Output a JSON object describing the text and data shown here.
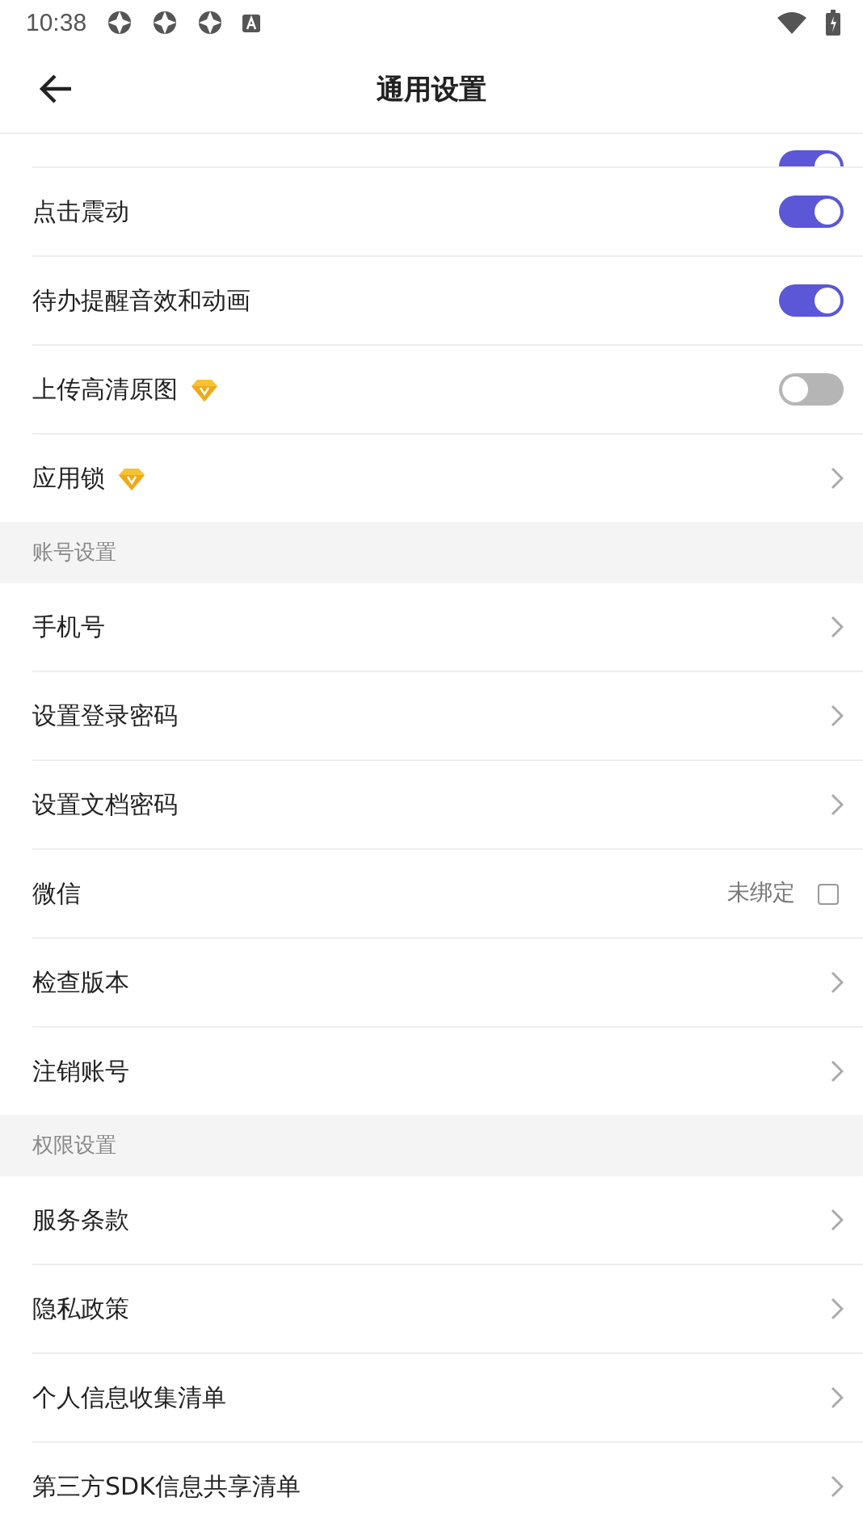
{
  "status_bar": {
    "time": "10:38"
  },
  "header": {
    "title": "通用设置"
  },
  "sections": [
    {
      "items": [
        {
          "kind": "switch",
          "partial": true,
          "on": true
        },
        {
          "kind": "switch",
          "label": "点击震动",
          "on": true
        },
        {
          "kind": "switch",
          "label": "待办提醒音效和动画",
          "on": true
        },
        {
          "kind": "switch",
          "label": "上传高清原图",
          "vip": true,
          "on": false
        },
        {
          "kind": "link",
          "label": "应用锁",
          "vip": true
        }
      ]
    },
    {
      "title": "账号设置",
      "items": [
        {
          "kind": "link",
          "label": "手机号"
        },
        {
          "kind": "link",
          "label": "设置登录密码"
        },
        {
          "kind": "link",
          "label": "设置文档密码"
        },
        {
          "kind": "bind",
          "label": "微信",
          "value": "未绑定",
          "checked": false
        },
        {
          "kind": "link",
          "label": "检查版本"
        },
        {
          "kind": "link",
          "label": "注销账号"
        }
      ]
    },
    {
      "title": "权限设置",
      "items": [
        {
          "kind": "link",
          "label": "服务条款"
        },
        {
          "kind": "link",
          "label": "隐私政策"
        },
        {
          "kind": "link",
          "label": "个人信息收集清单"
        },
        {
          "kind": "link",
          "label": "第三方SDK信息共享清单"
        }
      ]
    }
  ]
}
